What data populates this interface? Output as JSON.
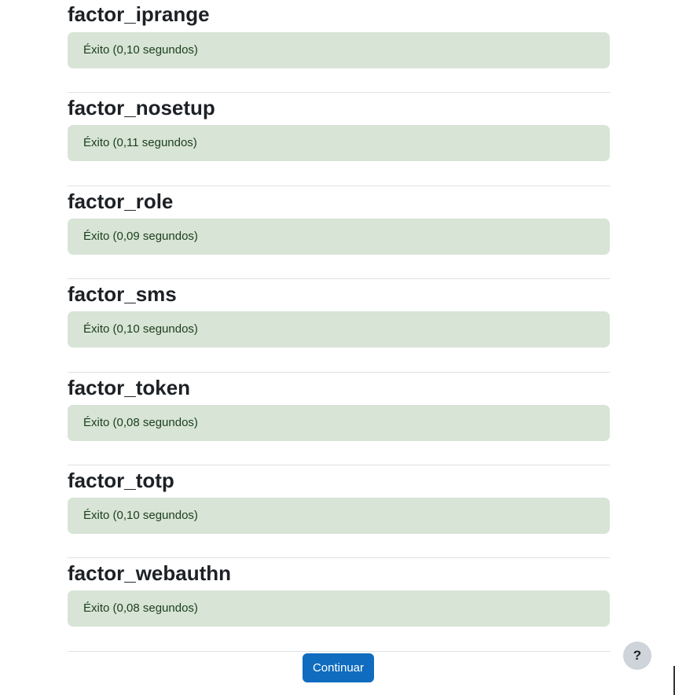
{
  "results": [
    {
      "plugin": "factor_iprange",
      "status": "Éxito (0,10 segundos)"
    },
    {
      "plugin": "factor_nosetup",
      "status": "Éxito (0,11 segundos)"
    },
    {
      "plugin": "factor_role",
      "status": "Éxito (0,09 segundos)"
    },
    {
      "plugin": "factor_sms",
      "status": "Éxito (0,10 segundos)"
    },
    {
      "plugin": "factor_token",
      "status": "Éxito (0,08 segundos)"
    },
    {
      "plugin": "factor_totp",
      "status": "Éxito (0,10 segundos)"
    },
    {
      "plugin": "factor_webauthn",
      "status": "Éxito (0,08 segundos)"
    }
  ],
  "footer": {
    "continue_label": "Continuar",
    "help_label": "?"
  },
  "colors": {
    "success_bg": "#d7e4d6",
    "success_text": "#1c3f1a",
    "primary": "#0f6cbf"
  }
}
